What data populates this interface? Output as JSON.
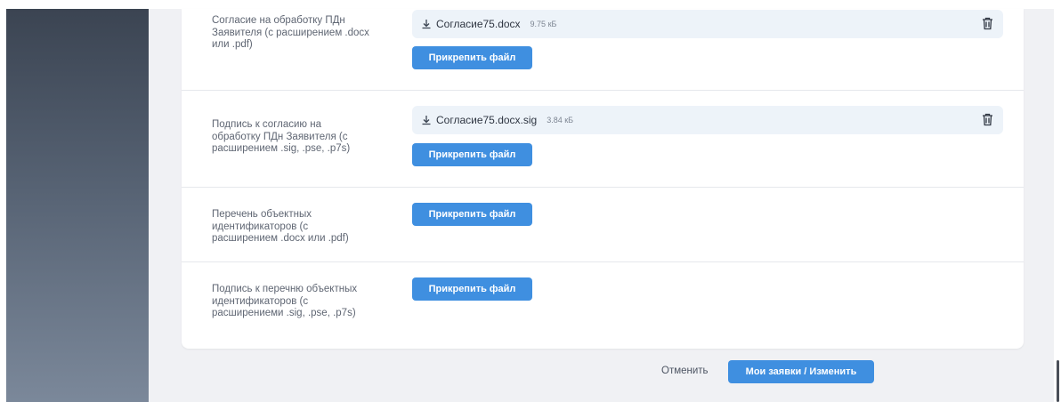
{
  "sections": [
    {
      "label": "Согласие на обработку ПДн Заявителя (с расширением .docx или .pdf)",
      "file": {
        "name": "Согласие75.docx",
        "size": "9.75 кБ",
        "icon": "download-icon"
      },
      "attach_label": "Прикрепить файл"
    },
    {
      "label": "Подпись к согласию на обработку ПДн Заявителя (с расширением .sig, .pse, .p7s)",
      "file": {
        "name": "Согласие75.docx.sig",
        "size": "3.84 кБ",
        "icon": "download-icon"
      },
      "attach_label": "Прикрепить файл"
    },
    {
      "label": "Перечень объектных идентификаторов (с расширением .docx или .pdf)",
      "attach_label": "Прикрепить файл"
    },
    {
      "label": "Подпись к перечню объектных идентификаторов (с расширениеми .sig, .pse, .p7s)",
      "attach_label": "Прикрепить файл"
    }
  ],
  "footer": {
    "cancel_label": "Отменить",
    "primary_label": "Мои заявки / Изменить"
  },
  "colors": {
    "accent": "#3f8fe0",
    "chip_bg": "#edf3f9",
    "page_bg": "#f0f1f4"
  }
}
